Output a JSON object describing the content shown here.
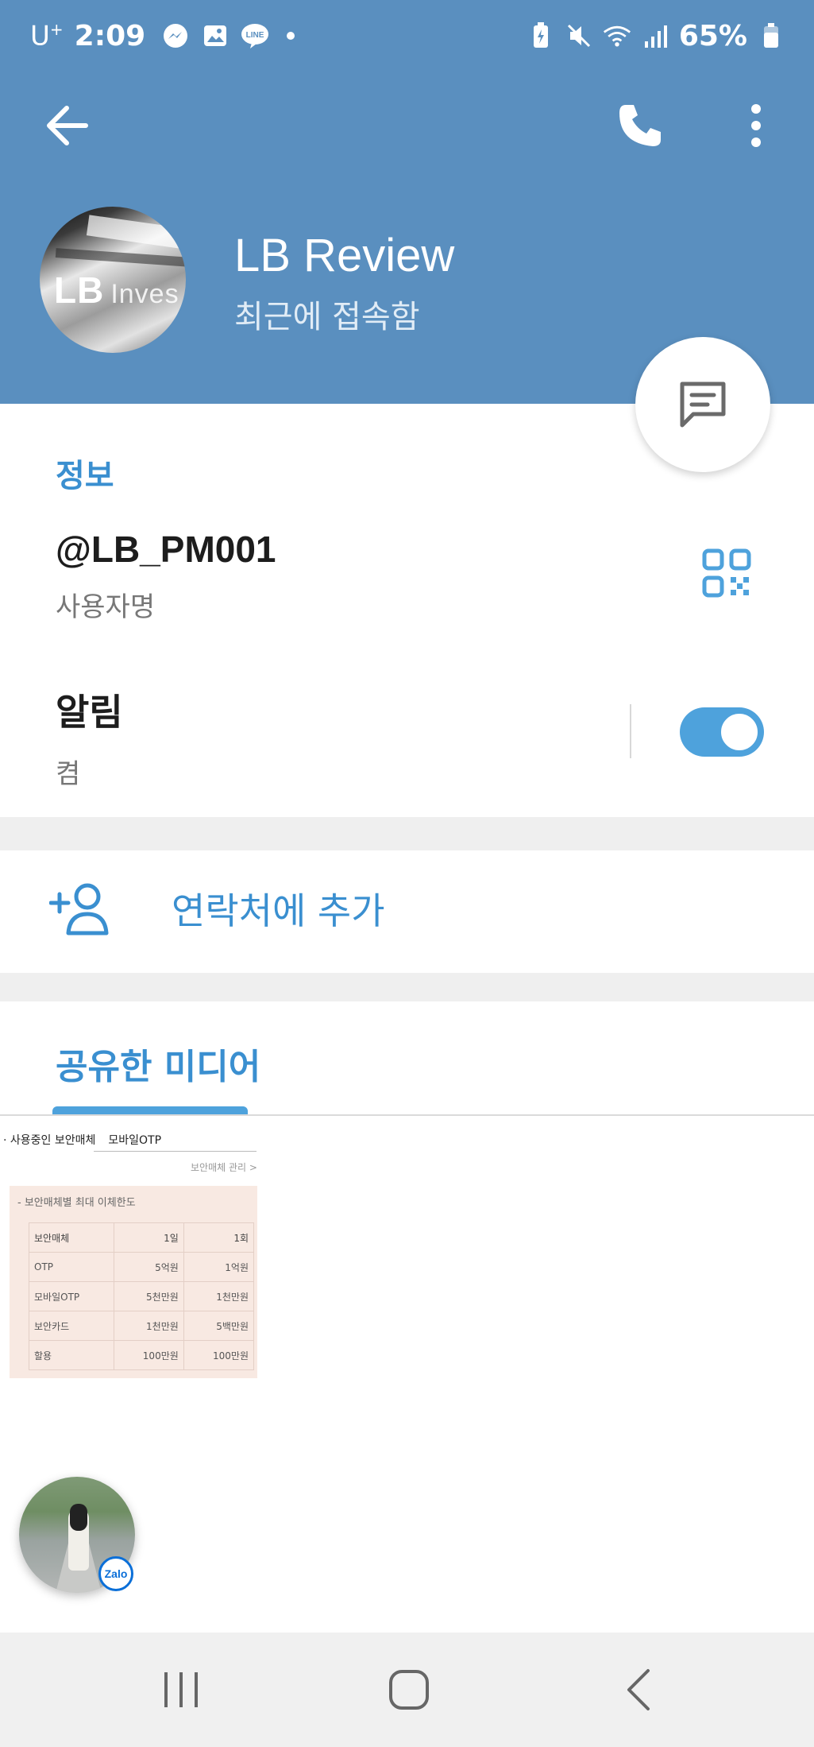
{
  "status_bar": {
    "carrier": "U",
    "carrier_sup": "+",
    "time": "2:09",
    "battery": "65%"
  },
  "profile": {
    "name": "LB Review",
    "status": "최근에 접속함",
    "avatar_text": "LB",
    "avatar_text2": "Inves"
  },
  "info": {
    "section_title": "정보",
    "username": "@LB_PM001",
    "username_label": "사용자명",
    "notify_title": "알림",
    "notify_value": "켬",
    "notify_on": true
  },
  "add_contact": {
    "label": "연락처에 추가"
  },
  "media": {
    "title": "공유한 미디어",
    "thumb": {
      "head_label": "· 사용중인 보안매체",
      "head_value": "모바일OTP",
      "manage": "보안매체 관리 >",
      "card_title": "- 보안매체별 최대 이체한도",
      "table": [
        [
          "보안매체",
          "1일",
          "1회"
        ],
        [
          "OTP",
          "5억원",
          "1억원"
        ],
        [
          "모바일OTP",
          "5천만원",
          "1천만원"
        ],
        [
          "보안카드",
          "1천만원",
          "5백만원"
        ],
        [
          "할용",
          "100만원",
          "100만원"
        ]
      ]
    }
  },
  "zalo": {
    "badge": "Zalo"
  },
  "icons": {
    "back": "arrow-left-icon",
    "call": "phone-icon",
    "more": "more-vertical-icon",
    "message": "message-icon",
    "qr": "qr-code-icon",
    "add_contact": "add-person-icon"
  },
  "colors": {
    "header": "#5a8fbf",
    "accent": "#3a8fd0",
    "toggle": "#4ea2dc"
  }
}
